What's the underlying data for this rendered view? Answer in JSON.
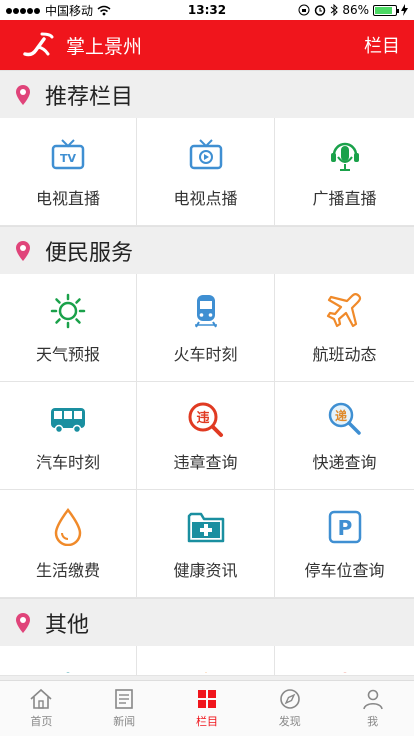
{
  "status": {
    "carrier": "中国移动",
    "time": "13:32",
    "battery": "86%",
    "battery_level": 0.86
  },
  "header": {
    "title": "掌上景州",
    "menu": "栏目"
  },
  "sections": [
    {
      "title": "推荐栏目",
      "items": [
        {
          "label": "电视直播",
          "icon": "tv-live-icon"
        },
        {
          "label": "电视点播",
          "icon": "tv-vod-icon"
        },
        {
          "label": "广播直播",
          "icon": "radio-mic-icon"
        }
      ]
    },
    {
      "title": "便民服务",
      "items": [
        {
          "label": "天气预报",
          "icon": "sun-icon"
        },
        {
          "label": "火车时刻",
          "icon": "train-icon"
        },
        {
          "label": "航班动态",
          "icon": "plane-icon"
        },
        {
          "label": "汽车时刻",
          "icon": "bus-icon"
        },
        {
          "label": "违章查询",
          "icon": "violation-icon"
        },
        {
          "label": "快递查询",
          "icon": "express-search-icon"
        },
        {
          "label": "生活缴费",
          "icon": "drop-icon"
        },
        {
          "label": "健康资讯",
          "icon": "medical-folder-icon"
        },
        {
          "label": "停车位查询",
          "icon": "parking-icon"
        }
      ]
    },
    {
      "title": "其他"
    }
  ],
  "tabbar": [
    {
      "label": "首页",
      "icon": "home-icon"
    },
    {
      "label": "新闻",
      "icon": "news-icon"
    },
    {
      "label": "栏目",
      "icon": "grid-icon",
      "active": true
    },
    {
      "label": "发现",
      "icon": "compass-icon"
    },
    {
      "label": "我",
      "icon": "person-icon"
    }
  ],
  "colors": {
    "brand": "#f0151c",
    "pin": "#e0447a",
    "tv": "#3f8fd2",
    "green": "#1aa14a",
    "orange": "#f08a2a",
    "teal": "#1a8fa0"
  },
  "icon_text": {
    "tv": "TV",
    "express": "递",
    "violation": "违",
    "parking": "P"
  }
}
